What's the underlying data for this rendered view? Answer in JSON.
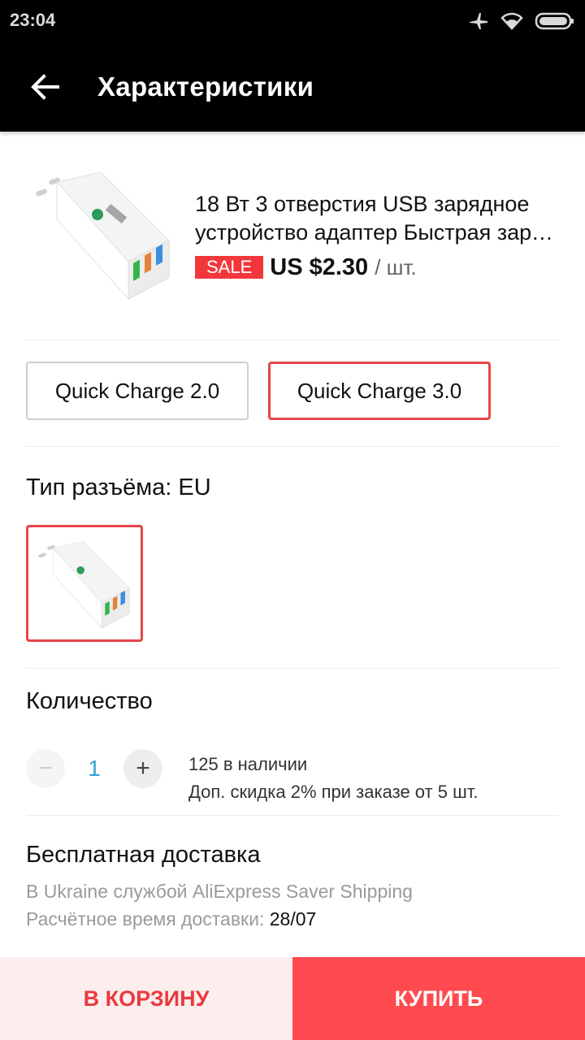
{
  "status_bar": {
    "time": "23:04",
    "icons": [
      "airplane-icon",
      "wifi-icon",
      "battery-icon"
    ]
  },
  "toolbar": {
    "back_icon": "arrow-left-icon",
    "title": "Характеристики"
  },
  "product": {
    "title_line1": "18 Вт 3 отверстия USB зарядное",
    "title_line2": "устройство адаптер Быстрая зарядка",
    "sale_badge": "SALE",
    "price": "US $2.30",
    "unit": "/ шт."
  },
  "options": {
    "items": [
      {
        "label": "Quick Charge 2.0",
        "selected": false
      },
      {
        "label": "Quick Charge 3.0",
        "selected": true
      }
    ]
  },
  "plug_type": {
    "label": "Тип разъёма: EU"
  },
  "quantity": {
    "label": "Количество",
    "value": "1",
    "minus": "−",
    "plus": "+",
    "in_stock": "125 в наличии",
    "discount": "Доп. скидка 2% при заказе от 5 шт."
  },
  "shipping": {
    "title": "Бесплатная доставка",
    "method": "В Ukraine службой AliExpress Saver Shipping",
    "eta_label": "Расчётное время доставки:",
    "eta_date": "28/07"
  },
  "actions": {
    "cart": "В КОРЗИНУ",
    "buy": "КУПИТЬ"
  },
  "colors": {
    "accent": "#ff4a4f",
    "selected_border": "#e8444a",
    "qty_value": "#2ea3cc"
  }
}
